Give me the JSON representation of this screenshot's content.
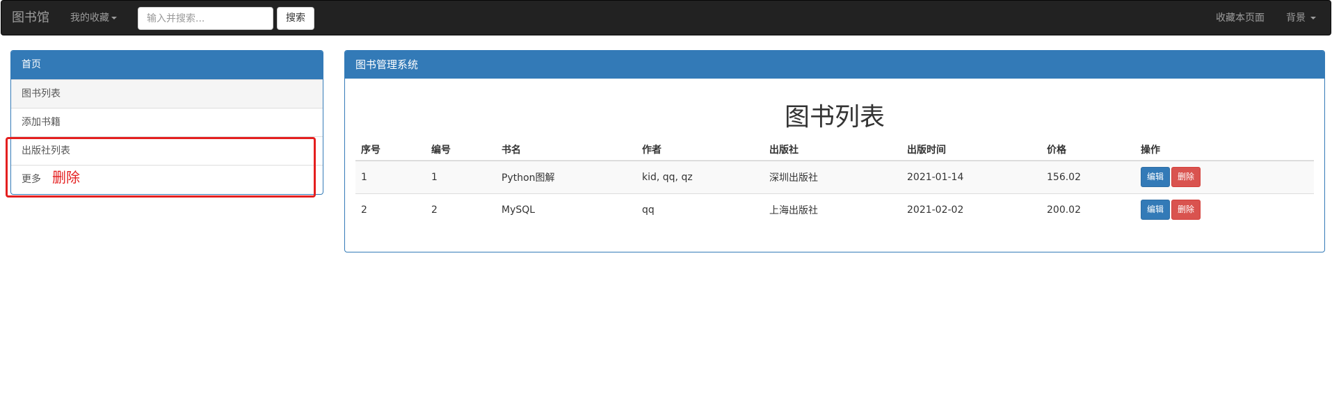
{
  "navbar": {
    "brand": "图书馆",
    "favorites_label": "我的收藏",
    "search_placeholder": "输入并搜索...",
    "search_button": "搜索",
    "bookmark_link": "收藏本页面",
    "background_label": "背景"
  },
  "sidebar": {
    "heading": "首页",
    "items": [
      {
        "label": "图书列表"
      },
      {
        "label": "添加书籍"
      },
      {
        "label": "出版社列表"
      },
      {
        "label": "更多"
      }
    ],
    "annotation": "删除"
  },
  "main": {
    "panel_title": "图书管理系统",
    "heading": "图书列表",
    "table": {
      "headers": [
        "序号",
        "编号",
        "书名",
        "作者",
        "出版社",
        "出版时间",
        "价格",
        "操作"
      ],
      "rows": [
        {
          "index": "1",
          "id": "1",
          "title": "Python图解",
          "author": "kid, qq, qz",
          "publisher": "深圳出版社",
          "date": "2021-01-14",
          "price": "156.02"
        },
        {
          "index": "2",
          "id": "2",
          "title": "MySQL",
          "author": "qq",
          "publisher": "上海出版社",
          "date": "2021-02-02",
          "price": "200.02"
        }
      ],
      "edit_label": "编辑",
      "delete_label": "删除"
    }
  },
  "colors": {
    "primary": "#337ab7",
    "danger": "#d9534f",
    "annotation_red": "#e41f1f",
    "navbar_bg": "#222222"
  }
}
